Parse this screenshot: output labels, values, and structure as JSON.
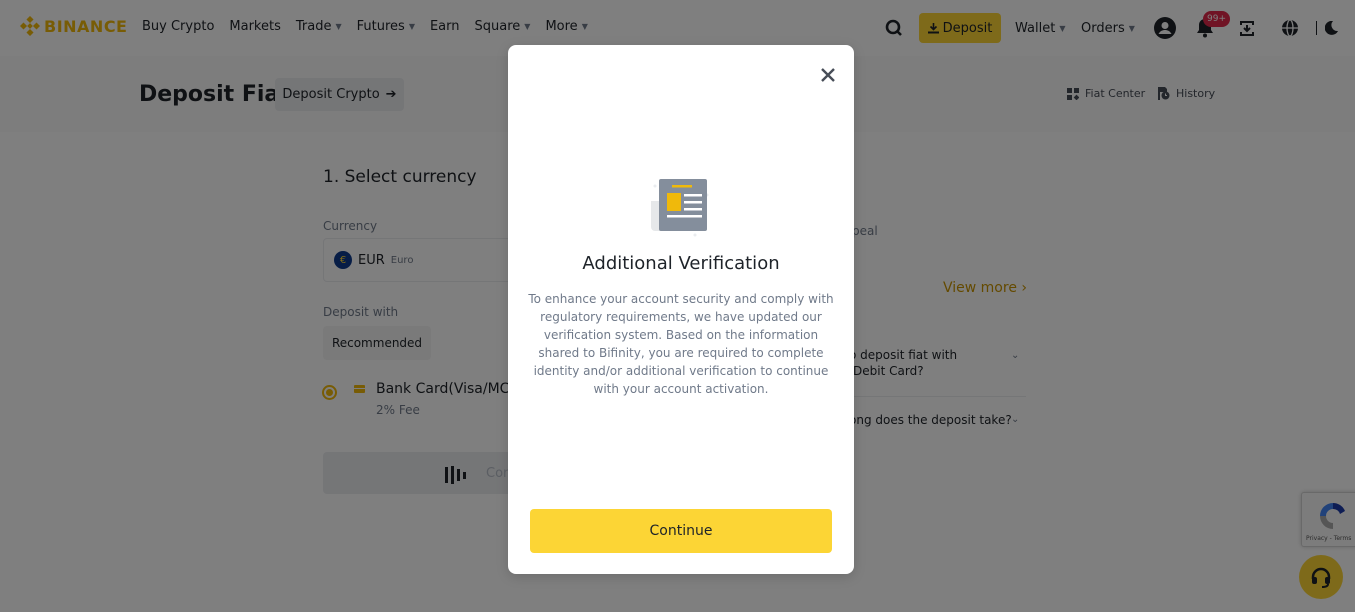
{
  "brand": {
    "name": "BINANCE",
    "accent": "#f0b90b",
    "button_yellow": "#fcd535"
  },
  "nav": {
    "links": [
      {
        "label": "Buy Crypto",
        "dropdown": false
      },
      {
        "label": "Markets",
        "dropdown": false
      },
      {
        "label": "Trade",
        "dropdown": true
      },
      {
        "label": "Futures",
        "dropdown": true
      },
      {
        "label": "Earn",
        "dropdown": false
      },
      {
        "label": "Square",
        "dropdown": true
      },
      {
        "label": "More",
        "dropdown": true
      }
    ],
    "deposit_label": "Deposit",
    "wallet_label": "Wallet",
    "orders_label": "Orders",
    "notification_badge": "99+",
    "icons": [
      "search-icon",
      "download-icon",
      "user-avatar-icon",
      "bell-icon",
      "transfer-icon",
      "globe-icon",
      "moon-icon"
    ]
  },
  "page": {
    "title": "Deposit Fiat",
    "deposit_crypto_label": "Deposit Crypto",
    "fiat_center_label": "Fiat Center",
    "history_label": "History"
  },
  "form": {
    "step_title": "1. Select currency",
    "currency_label": "Currency",
    "currency_code": "EUR",
    "currency_name": "Euro",
    "currency_symbol": "€",
    "deposit_with_label": "Deposit with",
    "method_tab": "Recommended",
    "method_name": "Bank Card(Visa/MC)",
    "method_fee": "2% Fee",
    "confirm_label": "Continue"
  },
  "sidebar": {
    "partial_text_1": "peal",
    "view_more_label": "View more",
    "faq": [
      {
        "line1": "o deposit fiat with",
        "line2": "/Debit Card?"
      },
      {
        "line1": "ong does the deposit take?"
      }
    ]
  },
  "recaptcha": {
    "text": "Privacy - Terms"
  },
  "modal": {
    "title": "Additional Verification",
    "body": "To enhance your account security and comply with regulatory requirements, we have updated our verification system. Based on the information shared to Bifinity, you are required to complete identity and/or additional verification to continue with your account activation.",
    "continue_label": "Continue"
  }
}
